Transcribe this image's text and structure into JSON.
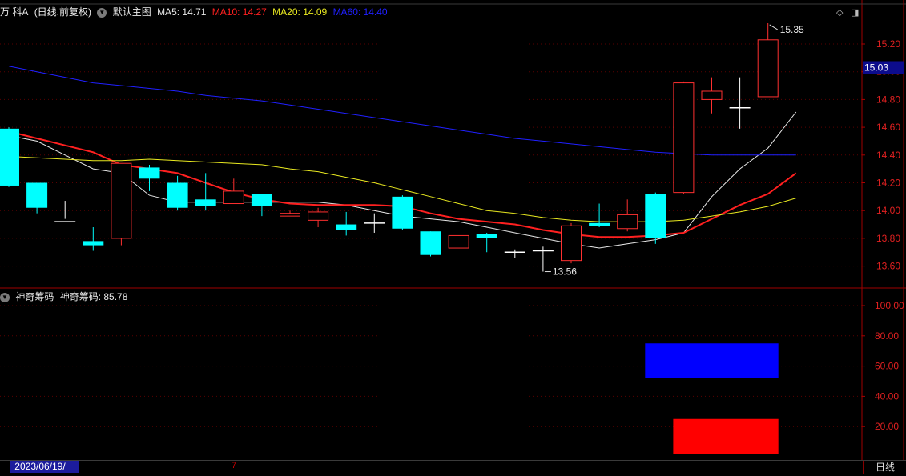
{
  "header": {
    "stock_name": "万 科A",
    "period": "(日线.前复权)",
    "main_indicator": "默认主图",
    "ma": [
      {
        "label": "MA5: 14.71",
        "color": "#e8e8e8"
      },
      {
        "label": "MA10: 14.27",
        "color": "#ff2020"
      },
      {
        "label": "MA20: 14.09",
        "color": "#e8e820"
      },
      {
        "label": "MA60: 14.40",
        "color": "#2020ff"
      }
    ]
  },
  "sub_header": {
    "name": "神奇筹码",
    "value_label": "神奇筹码: 85.78"
  },
  "footer": {
    "date": "2023/06/19/一",
    "cursor_day": "7",
    "period_button": "日线"
  },
  "price_axis": {
    "ticks": [
      "15.20",
      "15.00",
      "14.80",
      "14.60",
      "14.40",
      "14.20",
      "14.00",
      "13.80",
      "13.60"
    ],
    "current_price": "15.03"
  },
  "indicator_axis": {
    "ticks": [
      "100.00",
      "80.00",
      "60.00",
      "40.00",
      "20.00"
    ]
  },
  "annotations": {
    "high": "15.35",
    "low": "13.56"
  },
  "colors": {
    "up": "#ff3030",
    "down": "#00ffff",
    "flat": "#ffffff",
    "axis_red": "#8b0000",
    "indicator_blue": "#0000ff",
    "indicator_red": "#ff0000"
  },
  "chart_data": [
    {
      "type": "candlestick",
      "title": "万 科A (日线.前复权)",
      "ylim": [
        13.48,
        15.48
      ],
      "ohlc": [
        {
          "o": 14.59,
          "h": 14.6,
          "l": 14.17,
          "c": 14.18
        },
        {
          "o": 14.2,
          "h": 14.2,
          "l": 13.98,
          "c": 14.02
        },
        {
          "o": 13.92,
          "h": 14.07,
          "l": 13.94,
          "c": 13.92
        },
        {
          "o": 13.78,
          "h": 13.88,
          "l": 13.71,
          "c": 13.75
        },
        {
          "o": 13.8,
          "h": 14.34,
          "l": 13.75,
          "c": 14.34
        },
        {
          "o": 14.31,
          "h": 14.33,
          "l": 14.14,
          "c": 14.23
        },
        {
          "o": 14.2,
          "h": 14.25,
          "l": 14.0,
          "c": 14.02
        },
        {
          "o": 14.08,
          "h": 14.27,
          "l": 14.0,
          "c": 14.03
        },
        {
          "o": 14.05,
          "h": 14.23,
          "l": 14.05,
          "c": 14.14
        },
        {
          "o": 14.12,
          "h": 14.12,
          "l": 13.96,
          "c": 14.03
        },
        {
          "o": 13.96,
          "h": 14.0,
          "l": 13.96,
          "c": 13.98
        },
        {
          "o": 13.93,
          "h": 14.02,
          "l": 13.88,
          "c": 13.99
        },
        {
          "o": 13.9,
          "h": 13.99,
          "l": 13.82,
          "c": 13.86
        },
        {
          "o": 13.91,
          "h": 13.98,
          "l": 13.84,
          "c": 13.91
        },
        {
          "o": 14.1,
          "h": 14.11,
          "l": 13.86,
          "c": 13.87
        },
        {
          "o": 13.85,
          "h": 13.85,
          "l": 13.67,
          "c": 13.68
        },
        {
          "o": 13.73,
          "h": 13.82,
          "l": 13.73,
          "c": 13.82
        },
        {
          "o": 13.83,
          "h": 13.84,
          "l": 13.7,
          "c": 13.8
        },
        {
          "o": 13.7,
          "h": 13.72,
          "l": 13.66,
          "c": 13.7
        },
        {
          "o": 13.71,
          "h": 13.74,
          "l": 13.56,
          "c": 13.71
        },
        {
          "o": 13.64,
          "h": 13.91,
          "l": 13.62,
          "c": 13.89
        },
        {
          "o": 13.91,
          "h": 14.05,
          "l": 13.88,
          "c": 13.89
        },
        {
          "o": 13.87,
          "h": 14.08,
          "l": 13.85,
          "c": 13.97
        },
        {
          "o": 14.12,
          "h": 14.13,
          "l": 13.76,
          "c": 13.8
        },
        {
          "o": 14.13,
          "h": 14.93,
          "l": 14.12,
          "c": 14.92
        },
        {
          "o": 14.8,
          "h": 14.96,
          "l": 14.7,
          "c": 14.86
        },
        {
          "o": 14.74,
          "h": 14.96,
          "l": 14.59,
          "c": 14.74
        },
        {
          "o": 14.82,
          "h": 15.35,
          "l": 14.82,
          "c": 15.23
        }
      ],
      "ma_series": [
        {
          "name": "MA5",
          "color": "#e8e8e8",
          "values": [
            14.54,
            14.5,
            14.4,
            14.3,
            14.27,
            14.11,
            14.06,
            14.06,
            14.06,
            14.06,
            14.06,
            14.06,
            14.04,
            14.0,
            13.96,
            13.94,
            13.92,
            13.88,
            13.84,
            13.8,
            13.76,
            13.73,
            13.76,
            13.79,
            13.84,
            14.1,
            14.3,
            14.45,
            14.71
          ]
        },
        {
          "name": "MA10",
          "color": "#ff2020",
          "values": [
            14.57,
            14.52,
            14.47,
            14.42,
            14.33,
            14.3,
            14.27,
            14.2,
            14.13,
            14.08,
            14.05,
            14.04,
            14.04,
            14.04,
            14.03,
            13.98,
            13.94,
            13.92,
            13.9,
            13.86,
            13.83,
            13.81,
            13.81,
            13.82,
            13.84,
            13.94,
            14.04,
            14.12,
            14.27
          ]
        },
        {
          "name": "MA20",
          "color": "#e8e820",
          "values": [
            14.39,
            14.38,
            14.37,
            14.36,
            14.36,
            14.37,
            14.36,
            14.35,
            14.34,
            14.33,
            14.3,
            14.28,
            14.24,
            14.2,
            14.15,
            14.1,
            14.05,
            14.0,
            13.98,
            13.95,
            13.93,
            13.92,
            13.92,
            13.92,
            13.93,
            13.96,
            13.99,
            14.03,
            14.09
          ]
        },
        {
          "name": "MA60",
          "color": "#2020ff",
          "values": [
            15.04,
            15.0,
            14.96,
            14.92,
            14.9,
            14.88,
            14.86,
            14.83,
            14.81,
            14.79,
            14.76,
            14.73,
            14.7,
            14.67,
            14.64,
            14.61,
            14.58,
            14.55,
            14.52,
            14.5,
            14.48,
            14.46,
            14.44,
            14.42,
            14.41,
            14.4,
            14.4,
            14.4,
            14.4
          ]
        }
      ]
    },
    {
      "type": "bar",
      "title": "神奇筹码",
      "ylim": [
        0,
        110
      ],
      "series": [
        {
          "name": "神奇筹码",
          "color": "#0000ff",
          "bars": [
            {
              "from_index": 23,
              "to_index": 27,
              "low": 52,
              "high": 75
            }
          ]
        },
        {
          "name": "",
          "color": "#ff0000",
          "bars": [
            {
              "from_index": 24,
              "to_index": 27,
              "low": 2,
              "high": 25
            }
          ]
        }
      ]
    }
  ]
}
